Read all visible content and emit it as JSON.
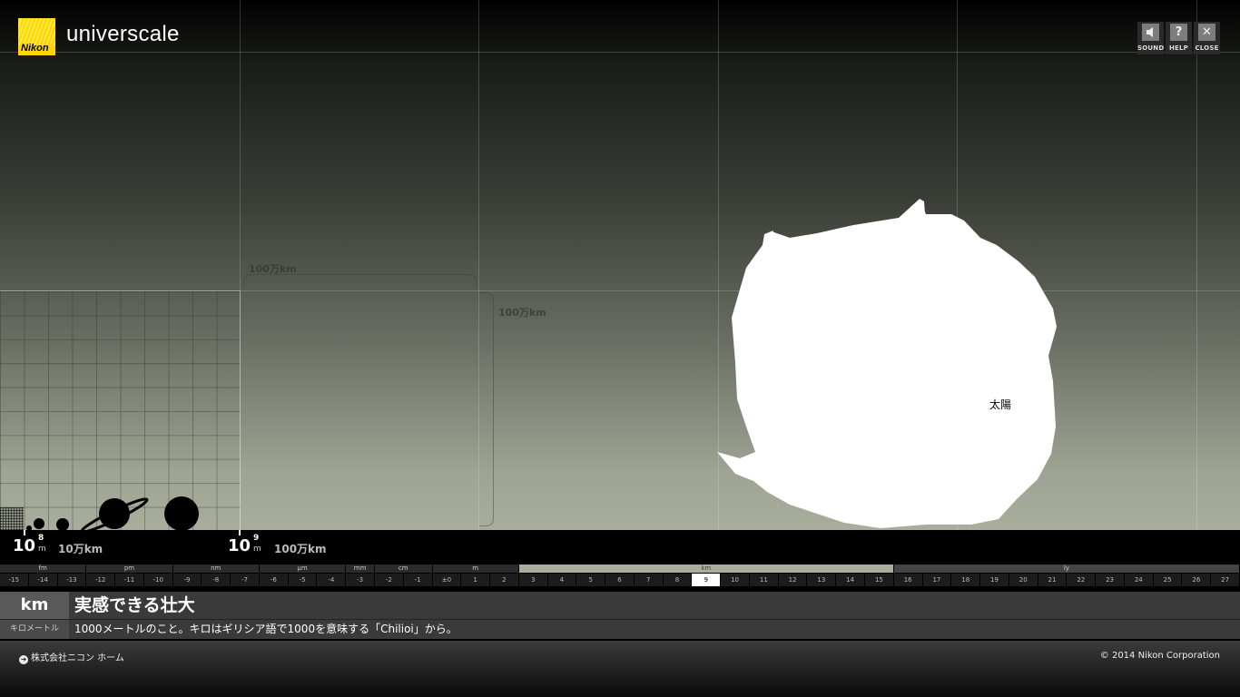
{
  "app": {
    "brand": "Nikon",
    "title": "universcale"
  },
  "controls": [
    {
      "label": "SOUND",
      "icon": "sound-icon"
    },
    {
      "label": "HELP",
      "icon": "help-icon",
      "glyph": "?"
    },
    {
      "label": "CLOSE",
      "icon": "close-icon",
      "glyph": "✕"
    }
  ],
  "scene": {
    "scale_label_top": "100万km",
    "scale_label_right": "100万km",
    "sun_label": "太陽"
  },
  "readouts": [
    {
      "base": "10",
      "exp": "8",
      "unit": "m",
      "km": "10万km"
    },
    {
      "base": "10",
      "exp": "9",
      "unit": "m",
      "km": "100万km"
    }
  ],
  "ruler": {
    "units": [
      {
        "label": "fm",
        "from": -15,
        "to": -13
      },
      {
        "label": "pm",
        "from": -12,
        "to": -10
      },
      {
        "label": "nm",
        "from": -9,
        "to": -7
      },
      {
        "label": "μm",
        "from": -6,
        "to": -4
      },
      {
        "label": "mm",
        "from": -3,
        "to": -3
      },
      {
        "label": "cm",
        "from": -2,
        "to": -1
      },
      {
        "label": "m",
        "from": 0,
        "to": 2
      },
      {
        "label": "km",
        "from": 3,
        "to": 15,
        "highlight": true
      },
      {
        "label": "ly",
        "from": 16,
        "to": 27,
        "dim": true
      }
    ],
    "exponents": [
      "-15",
      "-14",
      "-13",
      "-12",
      "-11",
      "-10",
      "-9",
      "-8",
      "-7",
      "-6",
      "-5",
      "-4",
      "-3",
      "-2",
      "-1",
      "±0",
      "1",
      "2",
      "3",
      "4",
      "5",
      "6",
      "7",
      "8",
      "9",
      "10",
      "11",
      "12",
      "13",
      "14",
      "15",
      "16",
      "17",
      "18",
      "19",
      "20",
      "21",
      "22",
      "23",
      "24",
      "25",
      "26",
      "27"
    ],
    "selected": "9"
  },
  "info": {
    "unit": "km",
    "title": "実感できる壮大",
    "reading": "キロメートル",
    "description": "1000メートルのこと。キロはギリシア語で1000を意味する「Chilioi」から。"
  },
  "footer": {
    "home_link": "株式会社ニコン ホーム",
    "copyright": "© 2014 Nikon Corporation"
  }
}
